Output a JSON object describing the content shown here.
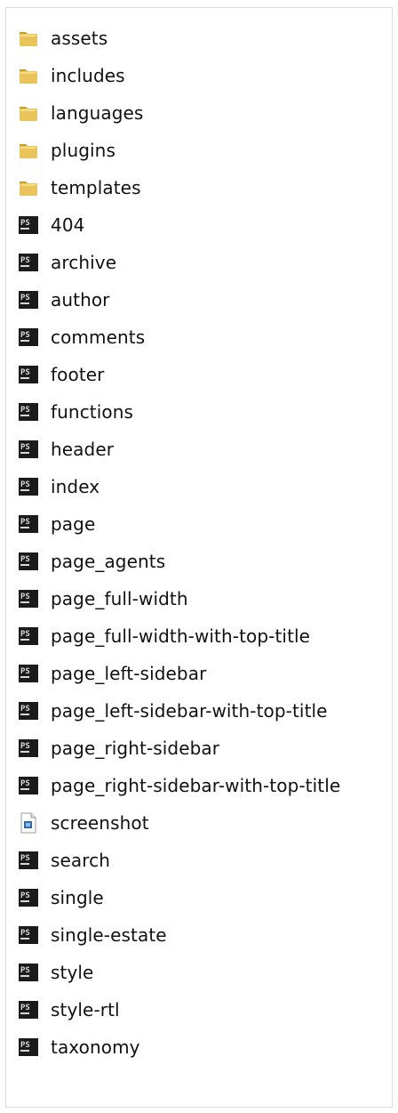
{
  "file_list": {
    "items": [
      {
        "label": "assets",
        "icon": "folder-icon"
      },
      {
        "label": "includes",
        "icon": "folder-icon"
      },
      {
        "label": "languages",
        "icon": "folder-icon"
      },
      {
        "label": "plugins",
        "icon": "folder-icon"
      },
      {
        "label": "templates",
        "icon": "folder-icon"
      },
      {
        "label": "404",
        "icon": "phpstorm-file-icon"
      },
      {
        "label": "archive",
        "icon": "phpstorm-file-icon"
      },
      {
        "label": "author",
        "icon": "phpstorm-file-icon"
      },
      {
        "label": "comments",
        "icon": "phpstorm-file-icon"
      },
      {
        "label": "footer",
        "icon": "phpstorm-file-icon"
      },
      {
        "label": "functions",
        "icon": "phpstorm-file-icon"
      },
      {
        "label": "header",
        "icon": "phpstorm-file-icon"
      },
      {
        "label": "index",
        "icon": "phpstorm-file-icon"
      },
      {
        "label": "page",
        "icon": "phpstorm-file-icon"
      },
      {
        "label": "page_agents",
        "icon": "phpstorm-file-icon"
      },
      {
        "label": "page_full-width",
        "icon": "phpstorm-file-icon"
      },
      {
        "label": "page_full-width-with-top-title",
        "icon": "phpstorm-file-icon"
      },
      {
        "label": "page_left-sidebar",
        "icon": "phpstorm-file-icon"
      },
      {
        "label": "page_left-sidebar-with-top-title",
        "icon": "phpstorm-file-icon"
      },
      {
        "label": "page_right-sidebar",
        "icon": "phpstorm-file-icon"
      },
      {
        "label": "page_right-sidebar-with-top-title",
        "icon": "phpstorm-file-icon"
      },
      {
        "label": "screenshot",
        "icon": "image-file-icon"
      },
      {
        "label": "search",
        "icon": "phpstorm-file-icon"
      },
      {
        "label": "single",
        "icon": "phpstorm-file-icon"
      },
      {
        "label": "single-estate",
        "icon": "phpstorm-file-icon"
      },
      {
        "label": "style",
        "icon": "phpstorm-file-icon"
      },
      {
        "label": "style-rtl",
        "icon": "phpstorm-file-icon"
      },
      {
        "label": "taxonomy",
        "icon": "phpstorm-file-icon"
      }
    ]
  },
  "colors": {
    "folder": "#e8c45a",
    "folder_shadow": "#c99d27",
    "ps_icon": "#1b1b1b",
    "ps_text": "#d8d8d8",
    "image_icon_blue": "#2b67b5"
  }
}
